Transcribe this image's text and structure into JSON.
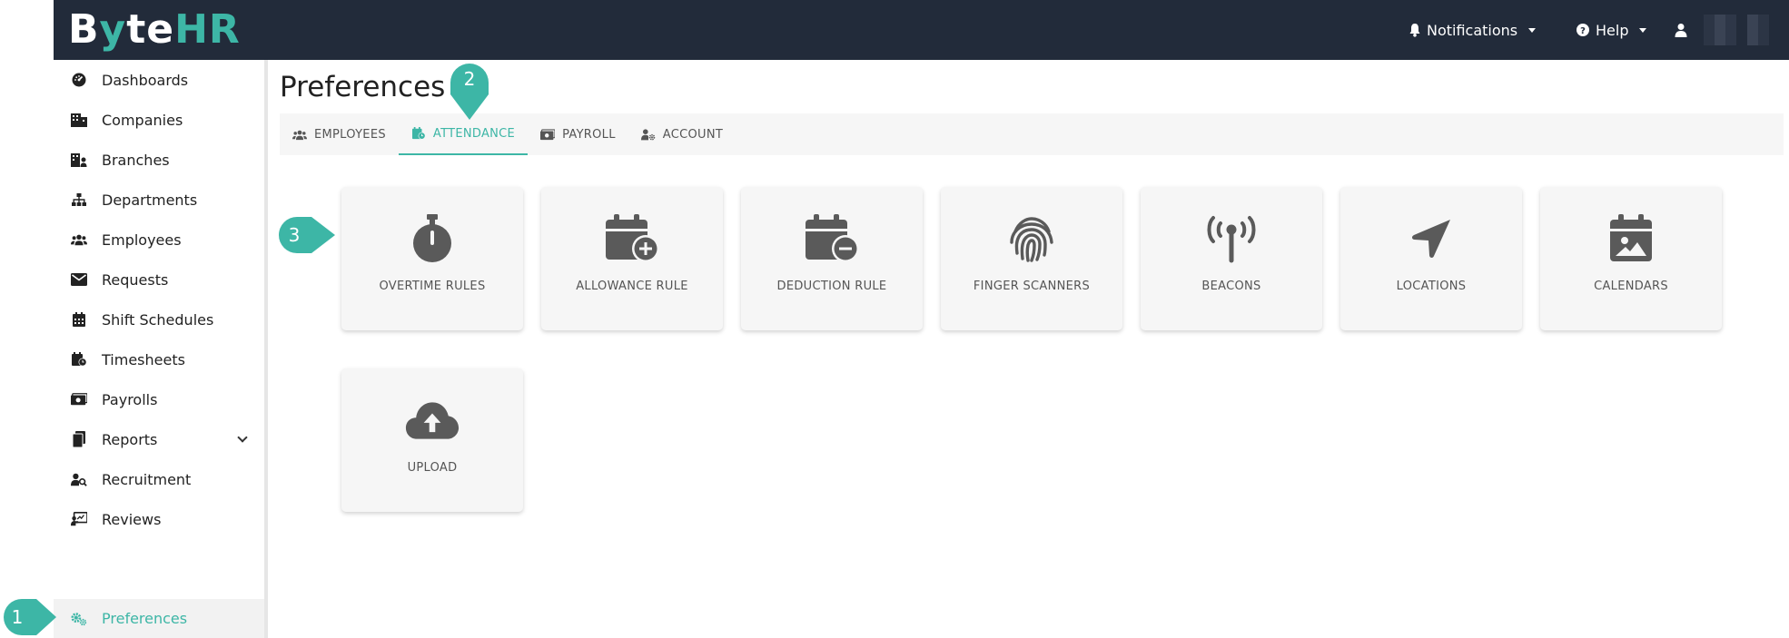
{
  "app": {
    "logo_b": "B",
    "logo_y": "y",
    "logo_te": "te",
    "logo_hr": "HR"
  },
  "topnav": {
    "notifications": "Notifications",
    "help": "Help",
    "user_name": ""
  },
  "sidebar": {
    "items": [
      {
        "label": "Dashboards",
        "icon": "gauge-icon"
      },
      {
        "label": "Companies",
        "icon": "building-icon"
      },
      {
        "label": "Branches",
        "icon": "branch-building-icon"
      },
      {
        "label": "Departments",
        "icon": "sitemap-icon"
      },
      {
        "label": "Employees",
        "icon": "users-icon"
      },
      {
        "label": "Requests",
        "icon": "envelope-icon"
      },
      {
        "label": "Shift Schedules",
        "icon": "calendar-icon"
      },
      {
        "label": "Timesheets",
        "icon": "calendar-clock-icon"
      },
      {
        "label": "Payrolls",
        "icon": "money-icon"
      },
      {
        "label": "Reports",
        "icon": "copy-icon"
      },
      {
        "label": "Recruitment",
        "icon": "user-search-icon"
      },
      {
        "label": "Reviews",
        "icon": "chalkboard-icon"
      },
      {
        "label": "Preferences",
        "icon": "gears-icon"
      }
    ],
    "active": "Preferences"
  },
  "page": {
    "title": "Preferences",
    "tabs": [
      {
        "label": "EMPLOYEES",
        "icon": "users-icon"
      },
      {
        "label": "ATTENDANCE",
        "icon": "calendar-clock-icon"
      },
      {
        "label": "PAYROLL",
        "icon": "money-icon"
      },
      {
        "label": "ACCOUNT",
        "icon": "user-gear-icon"
      }
    ],
    "active_tab": "ATTENDANCE",
    "cards": [
      {
        "label": "OVERTIME RULES",
        "icon": "stopwatch-icon"
      },
      {
        "label": "ALLOWANCE RULE",
        "icon": "calendar-plus-icon"
      },
      {
        "label": "DEDUCTION RULE",
        "icon": "calendar-minus-icon"
      },
      {
        "label": "FINGER SCANNERS",
        "icon": "fingerprint-icon"
      },
      {
        "label": "BEACONS",
        "icon": "broadcast-tower-icon"
      },
      {
        "label": "LOCATIONS",
        "icon": "location-arrow-icon"
      },
      {
        "label": "CALENDARS",
        "icon": "calendar-image-icon"
      },
      {
        "label": "UPLOAD",
        "icon": "cloud-upload-icon"
      }
    ]
  },
  "markers": {
    "m1": "1",
    "m2": "2",
    "m3": "3"
  },
  "colors": {
    "topbar": "#222b3a",
    "accent": "#3db6a6",
    "card": "#f6f6f6",
    "icon": "#5a5a5a"
  }
}
